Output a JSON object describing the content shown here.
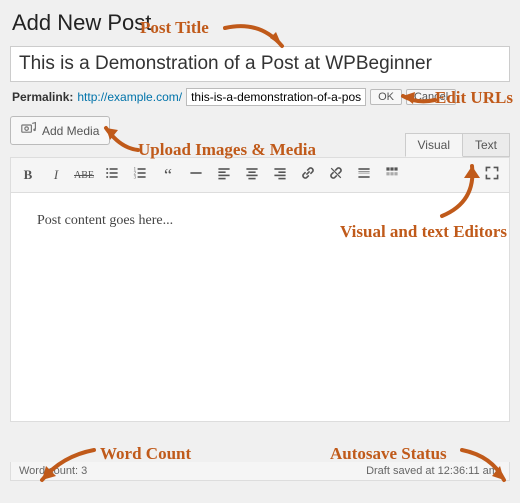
{
  "page": {
    "heading": "Add New Post"
  },
  "title": {
    "value": "This is a Demonstration of a Post at WPBeginner"
  },
  "permalink": {
    "label": "Permalink:",
    "base": "http://example.com/",
    "slug": "this-is-a-demonstration-of-a-pos",
    "ok": "OK",
    "cancel": "Cancel"
  },
  "media": {
    "button": "Add Media"
  },
  "tabs": {
    "visual": "Visual",
    "text": "Text"
  },
  "content": {
    "body": "Post content goes here..."
  },
  "status": {
    "wordcount_label": "Word count:",
    "wordcount_value": "3",
    "autosave": "Draft saved at 12:36:11 am."
  },
  "annotations": {
    "post_title": "Post Title",
    "edit_urls": "Edit URLs",
    "upload_media": "Upload Images & Media",
    "visual_text": "Visual and text Editors",
    "word_count": "Word Count",
    "autosave_status": "Autosave Status"
  }
}
